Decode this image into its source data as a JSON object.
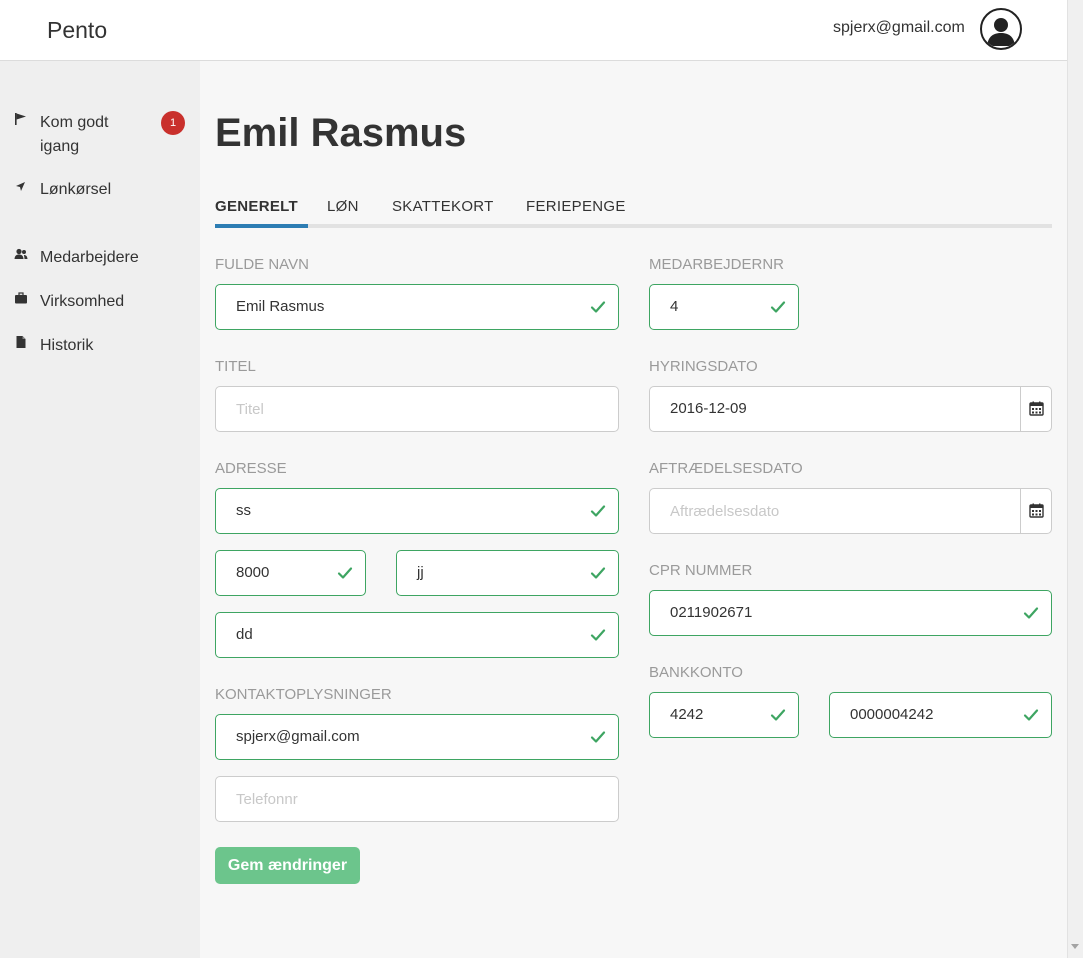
{
  "app": {
    "brand": "Pento",
    "user_email": "spjerx@gmail.com"
  },
  "sidebar": {
    "items": [
      {
        "label": "Kom godt igang",
        "badge": "1",
        "icon": "flag-icon"
      },
      {
        "label": "Lønkørsel",
        "icon": "send-arrow-icon"
      },
      {
        "label": "Medarbejdere",
        "icon": "users-icon"
      },
      {
        "label": "Virksomhed",
        "icon": "briefcase-icon"
      },
      {
        "label": "Historik",
        "icon": "document-icon"
      }
    ]
  },
  "page": {
    "title": "Emil Rasmus"
  },
  "tabs": [
    "GENERELT",
    "LØN",
    "SKATTEKORT",
    "FERIEPENGE"
  ],
  "active_tab": "GENERELT",
  "form": {
    "full_name": {
      "label": "FULDE NAVN",
      "value": "Emil Rasmus"
    },
    "title": {
      "label": "TITEL",
      "placeholder": "Titel"
    },
    "address": {
      "label": "ADRESSE",
      "street": "ss",
      "postal_code": "8000",
      "city": "jj",
      "extra": "dd"
    },
    "contact": {
      "label": "KONTAKTOPLYSNINGER",
      "email": "spjerx@gmail.com",
      "phone_placeholder": "Telefonnr"
    },
    "employee_no": {
      "label": "MEDARBEJDERNR",
      "value": "4"
    },
    "hire_date": {
      "label": "HYRINGSDATO",
      "value": "2016-12-09"
    },
    "termination_date": {
      "label": "AFTRÆDELSESDATO",
      "placeholder": "Aftrædelsesdato"
    },
    "cpr": {
      "label": "CPR NUMMER",
      "value": "0211902671"
    },
    "bank": {
      "label": "BANKKONTO",
      "reg_no": "4242",
      "account_no": "0000004242"
    },
    "save_label": "Gem ændringer"
  },
  "colors": {
    "valid": "#3ea562",
    "accent": "#2d7db3",
    "badge": "#c9302c",
    "save_button": "#6cc58c"
  }
}
